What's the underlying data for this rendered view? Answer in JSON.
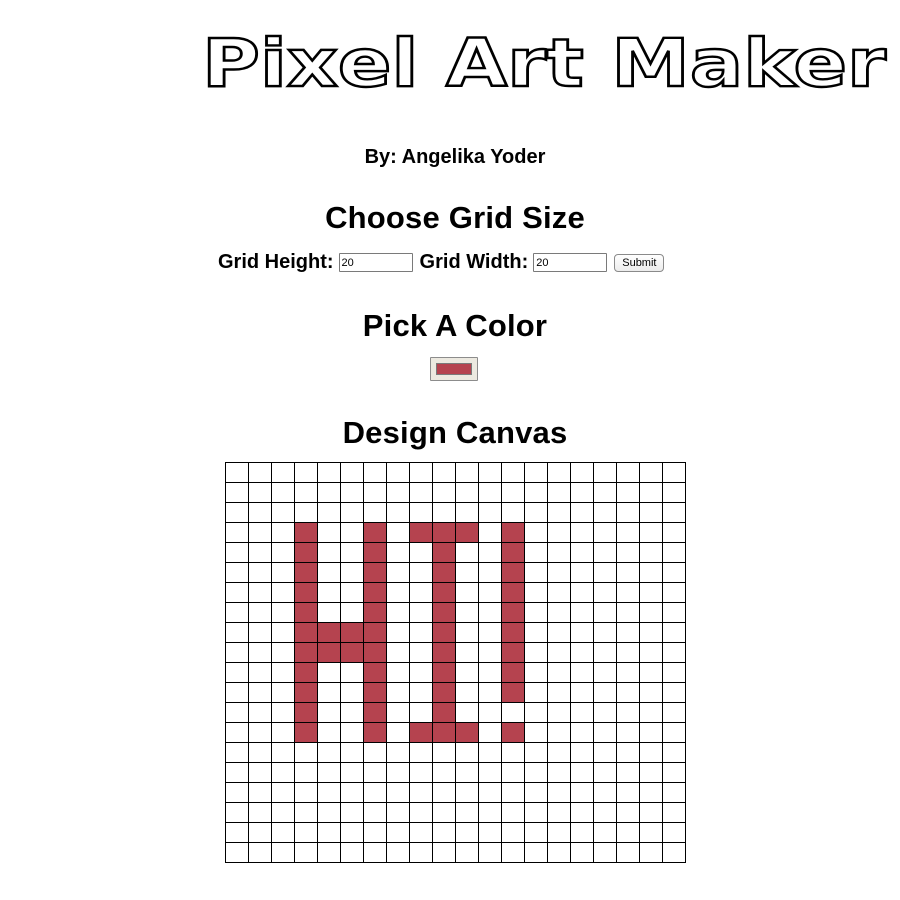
{
  "header": {
    "title": "Pixel Art Maker",
    "byline": "By: Angelika Yoder"
  },
  "grid_size": {
    "heading": "Choose Grid Size",
    "height_label": "Grid Height:",
    "height_value": "20",
    "width_label": "Grid Width:",
    "width_value": "20",
    "submit_label": "Submit"
  },
  "color_picker": {
    "heading": "Pick A Color",
    "value": "#b5434f"
  },
  "canvas": {
    "heading": "Design Canvas",
    "rows": 20,
    "cols": 20,
    "paint_color": "#b5434f",
    "painted_cells": [
      [
        3,
        3
      ],
      [
        3,
        6
      ],
      [
        3,
        8
      ],
      [
        3,
        9
      ],
      [
        3,
        10
      ],
      [
        3,
        12
      ],
      [
        4,
        3
      ],
      [
        4,
        6
      ],
      [
        4,
        9
      ],
      [
        4,
        12
      ],
      [
        5,
        3
      ],
      [
        5,
        6
      ],
      [
        5,
        9
      ],
      [
        5,
        12
      ],
      [
        6,
        3
      ],
      [
        6,
        6
      ],
      [
        6,
        9
      ],
      [
        6,
        12
      ],
      [
        7,
        3
      ],
      [
        7,
        6
      ],
      [
        7,
        9
      ],
      [
        7,
        12
      ],
      [
        8,
        3
      ],
      [
        8,
        4
      ],
      [
        8,
        5
      ],
      [
        8,
        6
      ],
      [
        8,
        9
      ],
      [
        8,
        12
      ],
      [
        9,
        3
      ],
      [
        9,
        4
      ],
      [
        9,
        5
      ],
      [
        9,
        6
      ],
      [
        9,
        9
      ],
      [
        9,
        12
      ],
      [
        10,
        3
      ],
      [
        10,
        6
      ],
      [
        10,
        9
      ],
      [
        10,
        12
      ],
      [
        11,
        3
      ],
      [
        11,
        6
      ],
      [
        11,
        9
      ],
      [
        11,
        12
      ],
      [
        12,
        3
      ],
      [
        12,
        6
      ],
      [
        12,
        9
      ],
      [
        13,
        3
      ],
      [
        13,
        6
      ],
      [
        13,
        8
      ],
      [
        13,
        9
      ],
      [
        13,
        10
      ],
      [
        13,
        12
      ]
    ]
  }
}
